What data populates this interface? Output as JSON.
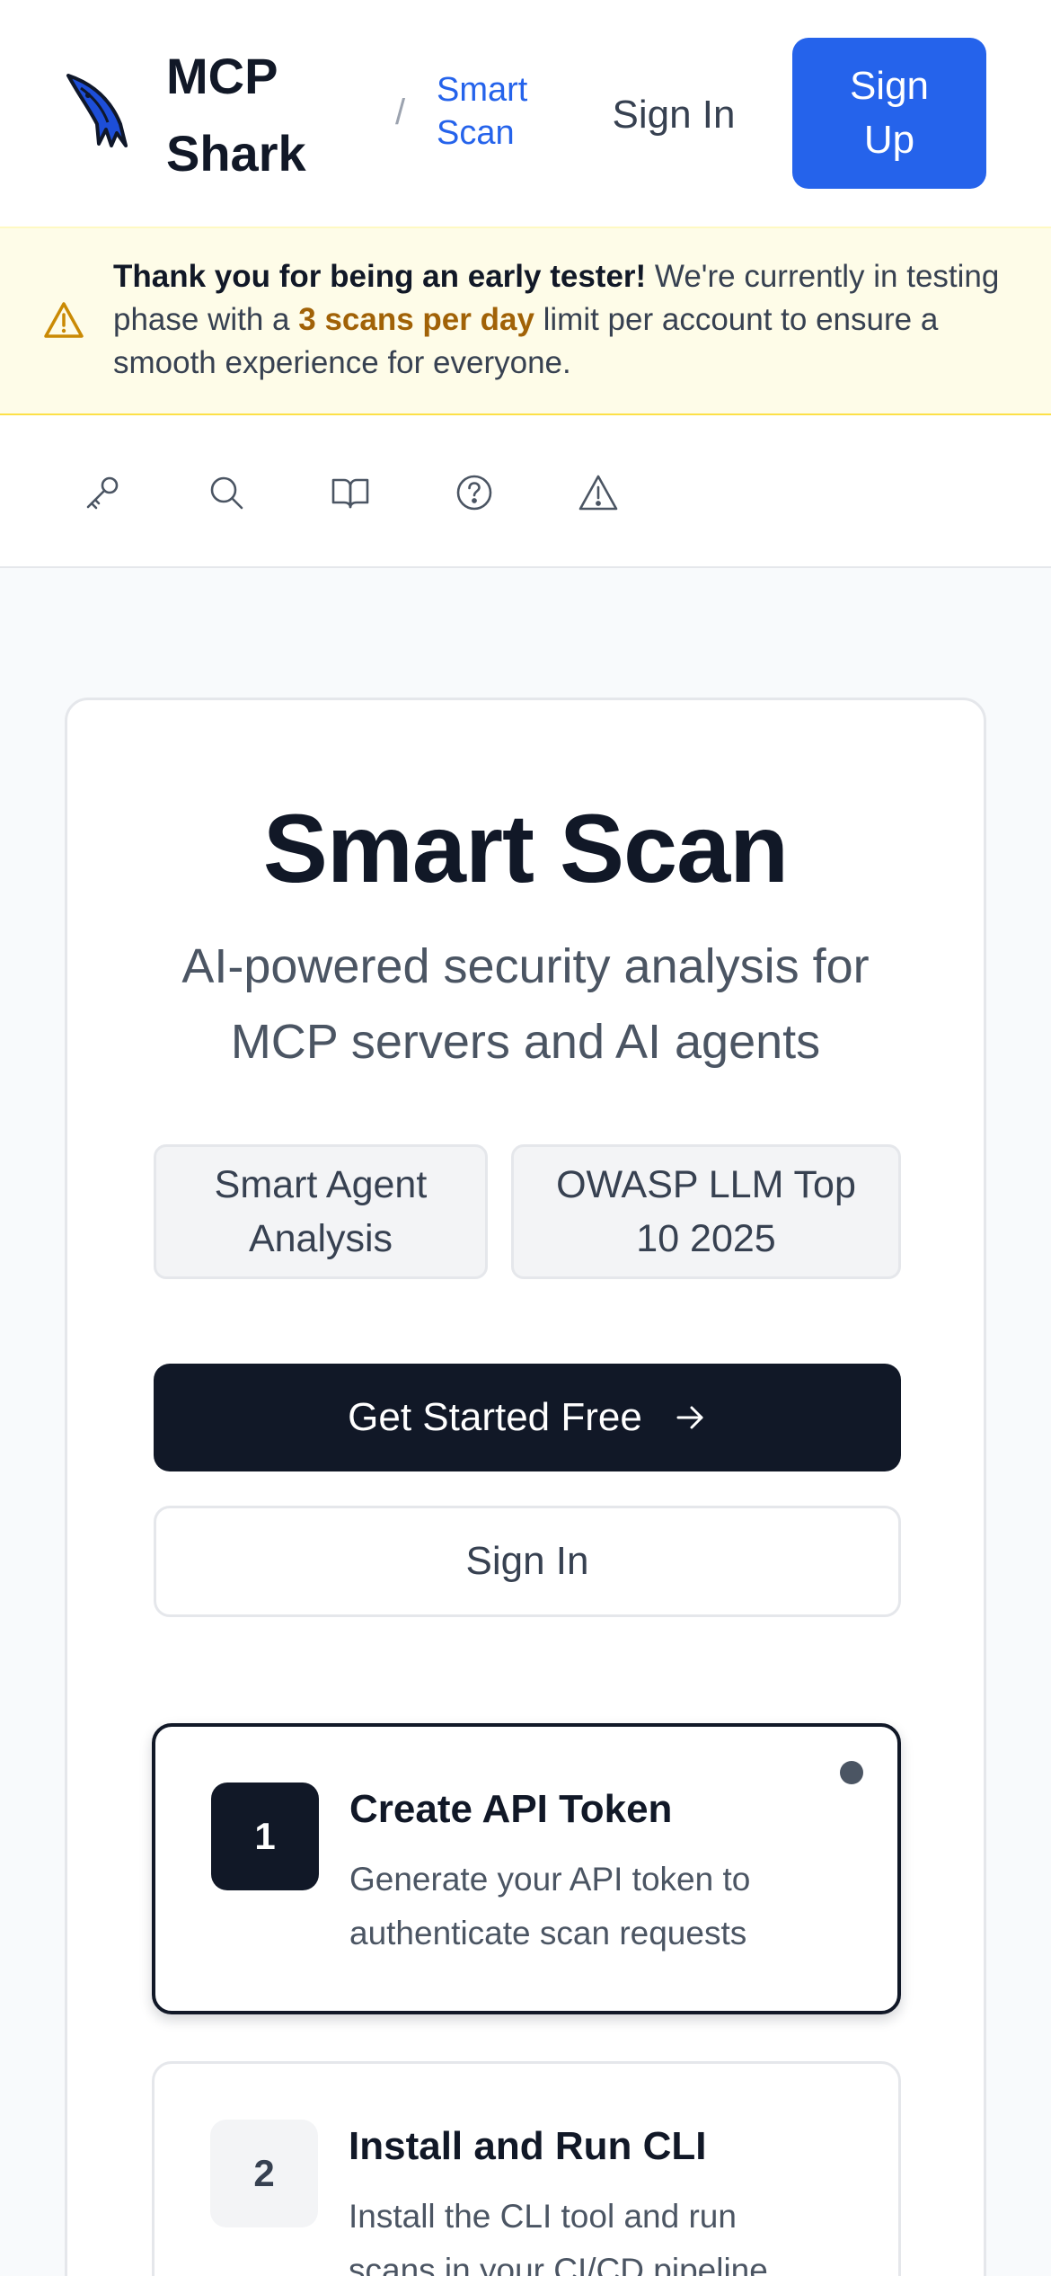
{
  "header": {
    "brand": "MCP Shark",
    "breadcrumb_separator": "/",
    "breadcrumb_current": "Smart Scan",
    "sign_in_label": "Sign In",
    "sign_up_label": "Sign Up",
    "logo_icon": "shark-logo-icon"
  },
  "banner": {
    "icon": "warning-triangle-icon",
    "strong_text": "Thank you for being an early tester!",
    "text_before": " We're currently in testing phase with a ",
    "highlight": "3 scans per day",
    "text_after": "  limit per account to ensure a smooth experience for everyone."
  },
  "toolbar": {
    "icons": [
      "key-icon",
      "search-icon",
      "book-icon",
      "help-circle-icon",
      "warning-triangle-icon"
    ]
  },
  "main": {
    "title": "Smart Scan",
    "subtitle": "AI-powered security analysis for MCP servers and AI agents",
    "badges": [
      "Smart Agent Analysis",
      "OWASP LLM Top 10 2025"
    ],
    "primary_cta": "Get Started Free",
    "secondary_cta": "Sign In",
    "steps": [
      {
        "number": "1",
        "title": "Create API Token",
        "description": "Generate your API token to authenticate scan requests",
        "active": true
      },
      {
        "number": "2",
        "title": "Install and Run CLI",
        "description": "Install the CLI tool and run scans in your CI/CD pipeline",
        "active": false
      }
    ]
  },
  "colors": {
    "accent": "#2563eb",
    "dark": "#111827",
    "banner_bg": "#fefce8",
    "banner_highlight": "#a16207"
  }
}
